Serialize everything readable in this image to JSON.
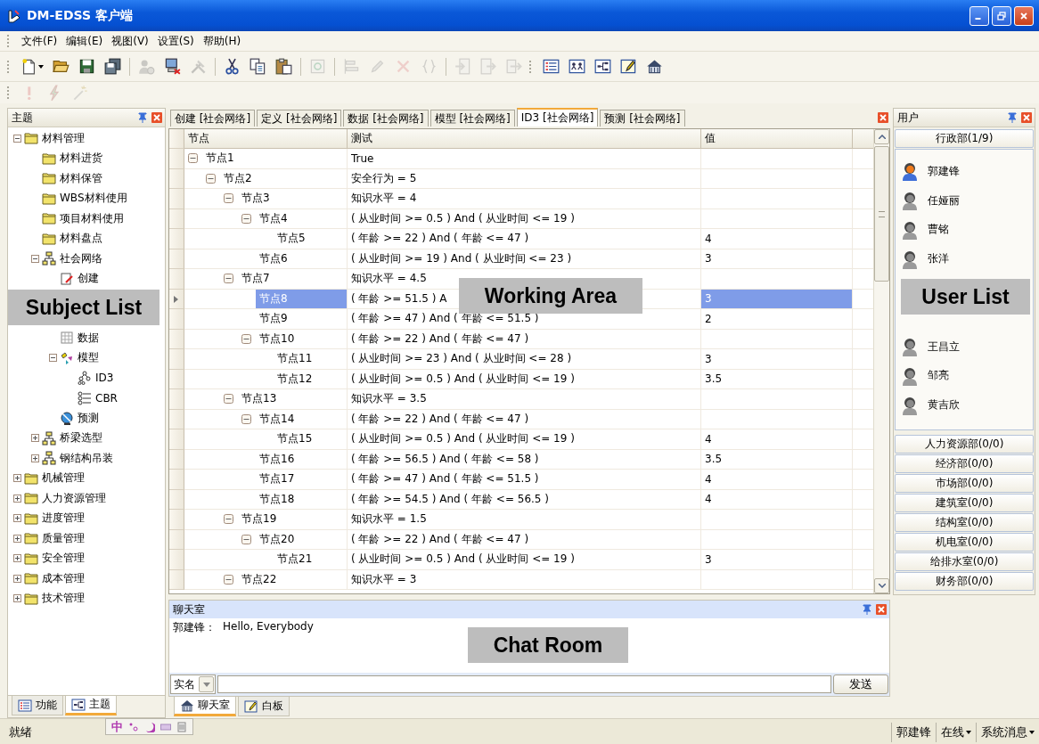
{
  "window": {
    "title": "DM-EDSS 客户端"
  },
  "menu": [
    "文件(F)",
    "编辑(E)",
    "视图(V)",
    "设置(S)",
    "帮助(H)"
  ],
  "toolbars": [
    [
      {
        "kind": "new",
        "disabled": false
      },
      {
        "kind": "open",
        "disabled": false
      },
      {
        "kind": "save",
        "disabled": false
      },
      {
        "kind": "save-all",
        "disabled": false
      },
      {
        "kind": "separator"
      },
      {
        "kind": "user-gear",
        "disabled": true
      },
      {
        "kind": "connect",
        "disabled": false
      },
      {
        "kind": "tools",
        "disabled": true
      },
      {
        "kind": "separator"
      },
      {
        "kind": "cut",
        "disabled": false
      },
      {
        "kind": "copy",
        "disabled": false
      },
      {
        "kind": "paste",
        "disabled": false
      },
      {
        "kind": "separator"
      },
      {
        "kind": "refresh",
        "disabled": true
      },
      {
        "kind": "separator"
      },
      {
        "kind": "align",
        "disabled": true
      },
      {
        "kind": "pencil",
        "disabled": true
      },
      {
        "kind": "delete",
        "disabled": true
      },
      {
        "kind": "braces",
        "disabled": true
      },
      {
        "kind": "separator"
      },
      {
        "kind": "import",
        "disabled": true
      },
      {
        "kind": "export",
        "disabled": true
      },
      {
        "kind": "forward",
        "disabled": true
      },
      {
        "kind": "grip"
      },
      {
        "kind": "list",
        "disabled": false
      },
      {
        "kind": "table",
        "disabled": false
      },
      {
        "kind": "diagram",
        "disabled": false
      },
      {
        "kind": "edit",
        "disabled": false
      },
      {
        "kind": "home",
        "disabled": false
      }
    ],
    [
      {
        "kind": "alert",
        "disabled": true
      },
      {
        "kind": "bolt",
        "disabled": true
      },
      {
        "kind": "wand",
        "disabled": true
      }
    ]
  ],
  "subject_panel": {
    "title": "主题",
    "annotation": "Subject List",
    "tree": [
      {
        "label": "材料管理",
        "kind": "folder",
        "expanded": true,
        "children": [
          {
            "label": "材料进货",
            "kind": "folder"
          },
          {
            "label": "材料保管",
            "kind": "folder"
          },
          {
            "label": "WBS材料使用",
            "kind": "folder"
          },
          {
            "label": "项目材料使用",
            "kind": "folder"
          },
          {
            "label": "材料盘点",
            "kind": "folder"
          },
          {
            "label": "社会网络",
            "kind": "network",
            "expanded": true,
            "children": [
              {
                "label": "创建",
                "kind": "create"
              },
              {
                "kind": "hidden"
              },
              {
                "label": "数据",
                "kind": "data"
              },
              {
                "label": "模型",
                "kind": "model",
                "expanded": true,
                "children": [
                  {
                    "label": "ID3",
                    "kind": "id3"
                  },
                  {
                    "label": "CBR",
                    "kind": "cbr"
                  }
                ]
              },
              {
                "label": "预测",
                "kind": "forecast"
              }
            ]
          },
          {
            "label": "桥梁选型",
            "kind": "network",
            "expanded": false
          },
          {
            "label": "钢结构吊装",
            "kind": "network",
            "expanded": false
          }
        ]
      },
      {
        "label": "机械管理",
        "kind": "folder",
        "expanded": false
      },
      {
        "label": "人力资源管理",
        "kind": "folder",
        "expanded": false
      },
      {
        "label": "进度管理",
        "kind": "folder",
        "expanded": false
      },
      {
        "label": "质量管理",
        "kind": "folder",
        "expanded": false
      },
      {
        "label": "安全管理",
        "kind": "folder",
        "expanded": false
      },
      {
        "label": "成本管理",
        "kind": "folder",
        "expanded": false
      },
      {
        "label": "技术管理",
        "kind": "folder",
        "expanded": false
      }
    ],
    "tabs": [
      {
        "label": "功能",
        "kind": "list",
        "selected": false
      },
      {
        "label": "主题",
        "kind": "diagram",
        "selected": true
      }
    ]
  },
  "ime_bar": {
    "label": "中"
  },
  "documents": {
    "annotation": "Working Area",
    "tabs": [
      {
        "label": "创建 [社会网络]",
        "selected": false
      },
      {
        "label": "定义 [社会网络]",
        "selected": false
      },
      {
        "label": "数据 [社会网络]",
        "selected": false
      },
      {
        "label": "模型 [社会网络]",
        "selected": false
      },
      {
        "label": "ID3 [社会网络]",
        "selected": true
      },
      {
        "label": "预测 [社会网络]",
        "selected": false
      }
    ],
    "grid": {
      "columns": [
        "节点",
        "测试",
        "值"
      ],
      "rows": [
        {
          "node": "节点1",
          "test": "True",
          "selected": false,
          "expanded": true,
          "children": [
            {
              "node": "节点2",
              "test": "安全行为 = 5",
              "selected": false,
              "expanded": true,
              "children": [
                {
                  "node": "节点3",
                  "test": "知识水平 = 4",
                  "selected": false,
                  "expanded": true,
                  "children": [
                    {
                      "node": "节点4",
                      "test": "( 从业时间 >= 0.5 ) And ( 从业时间 <= 19 )",
                      "selected": false,
                      "expanded": true,
                      "children": [
                        {
                          "node": "节点5",
                          "test": "( 年龄 >= 22 ) And ( 年龄 <= 47 )",
                          "value": "4",
                          "selected": false
                        }
                      ]
                    },
                    {
                      "node": "节点6",
                      "test": "( 从业时间 >= 19 ) And ( 从业时间 <= 23 )",
                      "value": "3",
                      "selected": false
                    }
                  ]
                },
                {
                  "node": "节点7",
                  "test": "知识水平 = 4.5",
                  "selected": false,
                  "expanded": true,
                  "children": [
                    {
                      "node": "节点8",
                      "test": "( 年龄 >= 51.5 ) A",
                      "value": "3",
                      "selected": true
                    },
                    {
                      "node": "节点9",
                      "test": "( 年龄 >= 47 ) And ( 年龄 <= 51.5 )",
                      "value": "2",
                      "selected": false
                    },
                    {
                      "node": "节点10",
                      "test": "( 年龄 >= 22 ) And ( 年龄 <= 47 )",
                      "selected": false,
                      "expanded": true,
                      "children": [
                        {
                          "node": "节点11",
                          "test": "( 从业时间 >= 23 ) And ( 从业时间 <= 28 )",
                          "value": "3",
                          "selected": false
                        },
                        {
                          "node": "节点12",
                          "test": "( 从业时间 >= 0.5 ) And ( 从业时间 <= 19 )",
                          "value": "3.5",
                          "selected": false
                        }
                      ]
                    }
                  ]
                },
                {
                  "node": "节点13",
                  "test": "知识水平 = 3.5",
                  "selected": false,
                  "expanded": true,
                  "children": [
                    {
                      "node": "节点14",
                      "test": "( 年龄 >= 22 ) And ( 年龄 <= 47 )",
                      "selected": false,
                      "expanded": true,
                      "children": [
                        {
                          "node": "节点15",
                          "test": "( 从业时间 >= 0.5 ) And ( 从业时间 <= 19 )",
                          "value": "4",
                          "selected": false
                        }
                      ]
                    },
                    {
                      "node": "节点16",
                      "test": "( 年龄 >= 56.5 ) And ( 年龄 <= 58 )",
                      "value": "3.5",
                      "selected": false
                    },
                    {
                      "node": "节点17",
                      "test": "( 年龄 >= 47 ) And ( 年龄 <= 51.5 )",
                      "value": "4",
                      "selected": false
                    },
                    {
                      "node": "节点18",
                      "test": "( 年龄 >= 54.5 ) And ( 年龄 <= 56.5 )",
                      "value": "4",
                      "selected": false
                    }
                  ]
                },
                {
                  "node": "节点19",
                  "test": "知识水平 = 1.5",
                  "selected": false,
                  "expanded": true,
                  "children": [
                    {
                      "node": "节点20",
                      "test": "( 年龄 >= 22 ) And ( 年龄 <= 47 )",
                      "selected": false,
                      "expanded": true,
                      "children": [
                        {
                          "node": "节点21",
                          "test": "( 从业时间 >= 0.5 ) And ( 从业时间 <= 19 )",
                          "value": "3",
                          "selected": false
                        }
                      ]
                    }
                  ]
                },
                {
                  "node": "节点22",
                  "test": "知识水平 = 3",
                  "selected": false,
                  "expanded": true
                }
              ]
            }
          ]
        }
      ]
    }
  },
  "chat": {
    "title": "聊天室",
    "annotation": "Chat Room",
    "messages": [
      {
        "sender": "郭建锋：",
        "text": "Hello, Everybody"
      }
    ],
    "name_mode": "实名",
    "send": "发送",
    "tabs": [
      {
        "label": "聊天室",
        "kind": "home",
        "selected": true
      },
      {
        "label": "白板",
        "kind": "edit",
        "selected": false
      }
    ]
  },
  "user_panel": {
    "title": "用户",
    "annotation": "User List",
    "groups": [
      {
        "label": "行政部(1/9)",
        "expanded": true,
        "users": [
          {
            "kind": "user",
            "name": "郭建锋",
            "online": true
          },
          {
            "kind": "user",
            "name": "任娅丽",
            "online": false
          },
          {
            "kind": "user",
            "name": "曹铭",
            "online": false
          },
          {
            "kind": "user",
            "name": "张洋",
            "online": false
          },
          {
            "kind": "hidden"
          },
          {
            "kind": "hidden"
          },
          {
            "kind": "user",
            "name": "王昌立",
            "online": false
          },
          {
            "kind": "user",
            "name": "邹亮",
            "online": false
          },
          {
            "kind": "user",
            "name": "黄吉欣",
            "online": false
          }
        ]
      },
      {
        "label": "人力资源部(0/0)"
      },
      {
        "label": "经济部(0/0)"
      },
      {
        "label": "市场部(0/0)"
      },
      {
        "label": "建筑室(0/0)"
      },
      {
        "label": "结构室(0/0)"
      },
      {
        "label": "机电室(0/0)"
      },
      {
        "label": "给排水室(0/0)"
      },
      {
        "label": "财务部(0/0)"
      }
    ]
  },
  "status_bar": {
    "text": "就绪",
    "user": "郭建锋",
    "presence": "在线",
    "messages": "系统消息"
  }
}
